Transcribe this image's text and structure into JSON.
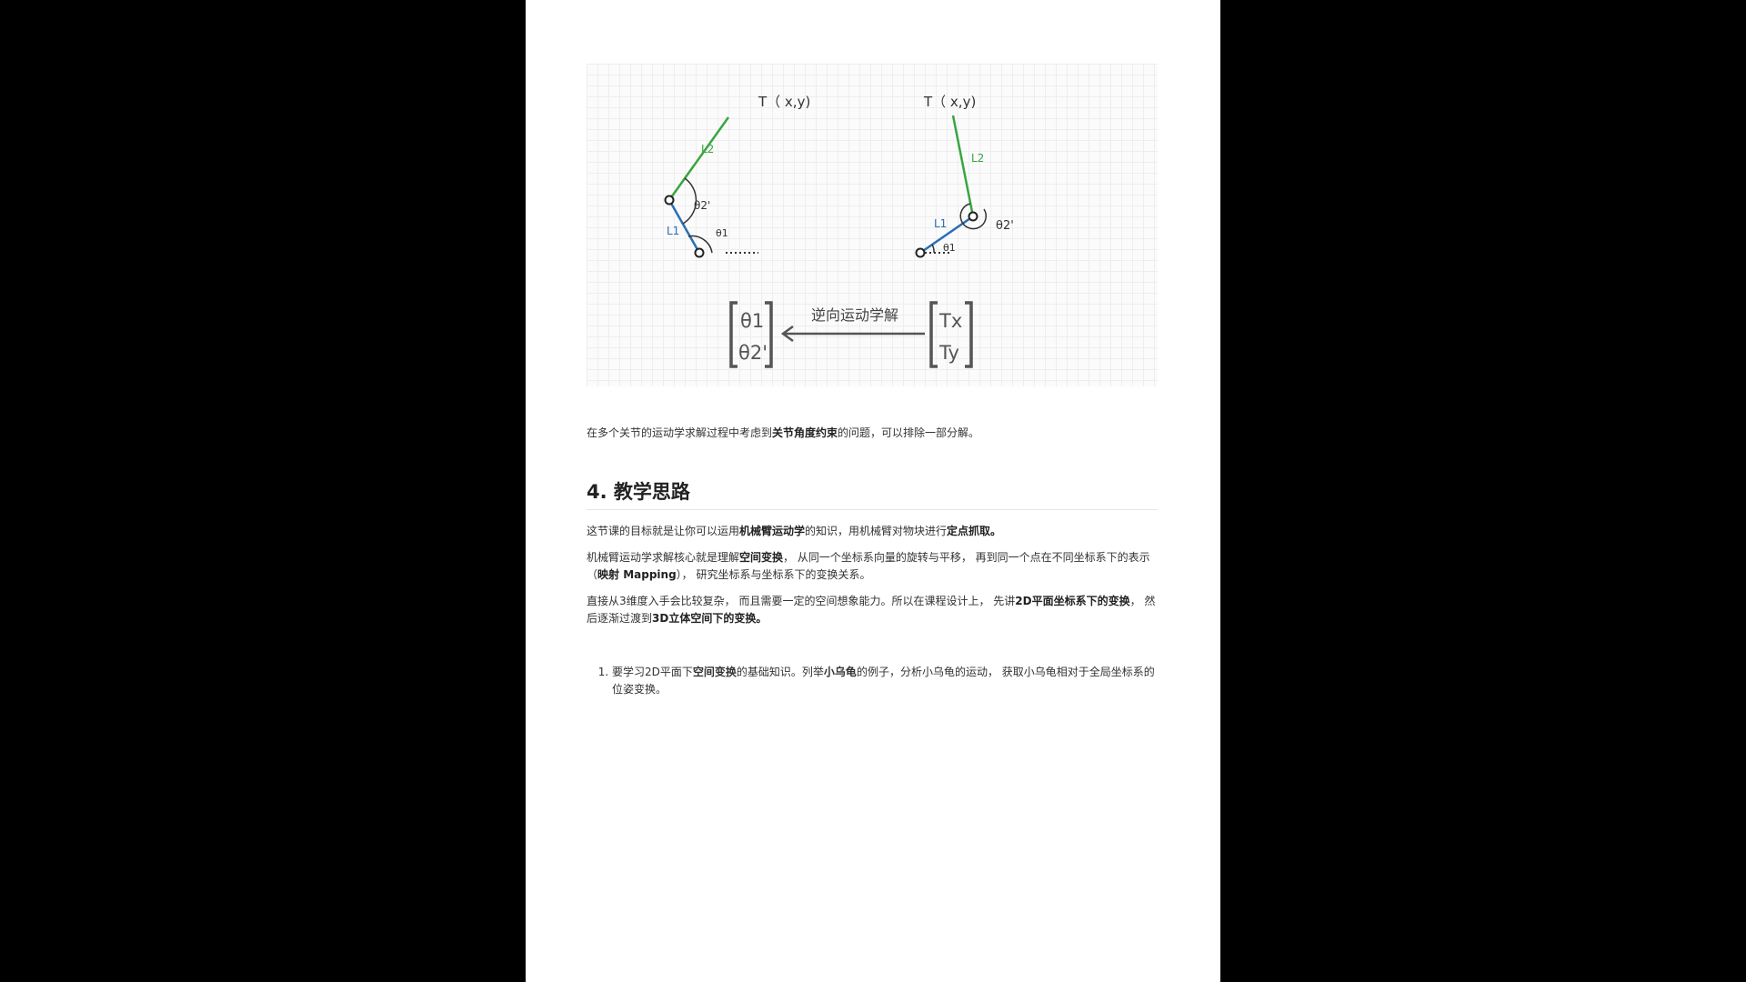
{
  "figure": {
    "left_arm": {
      "target": "T（ x,y)",
      "l2": "L2",
      "l1": "L1",
      "theta1": "θ1",
      "theta2": "θ2'"
    },
    "right_arm": {
      "target": "T（ x,y)",
      "l2": "L2",
      "l1": "L1",
      "theta1": "θ1",
      "theta2": "θ2'"
    },
    "matrix_left": [
      "θ1",
      "θ2'"
    ],
    "matrix_right": [
      "Tx",
      "Ty"
    ],
    "arrow_label": "逆向运动学解",
    "colors": {
      "l1": "#2a6fb5",
      "l2": "#3aa540",
      "ink": "#333333"
    }
  },
  "para_constraint": {
    "prefix": "在多个关节的运动学求解过程中考虑到",
    "bold": "关节角度约束",
    "suffix": "的问题，可以排除一部分解。"
  },
  "section": {
    "title": "4. 教学思路"
  },
  "para_goal": {
    "t1": "这节课的目标就是让你可以运用",
    "b1": "机械臂运动学",
    "t2": "的知识，用机械臂对物块进行",
    "b2": "定点抓取。"
  },
  "para_core": {
    "t1": "机械臂运动学求解核心就是理解",
    "b1": "空间变换",
    "t2": "， 从同一个坐标系向量的旋转与平移， 再到同一个点在不同坐标系下的表示（",
    "b2": "映射 Mapping",
    "t3": "）， 研究坐标系与坐标系下的变换关系。"
  },
  "para_design": {
    "t1": "直接从3维度入手会比较复杂， 而且需要一定的空间想象能力。所以在课程设计上， 先讲",
    "b1": "2D平面坐标系下的变换",
    "t2": "， 然后逐渐过渡到",
    "b2": "3D立体空间下的变换。"
  },
  "steps": [
    {
      "t1": "要学习2D平面下",
      "b1": "空间变换",
      "t2": "的基础知识。列举",
      "b2": "小乌龟",
      "t3": "的例子，分析小乌龟的运动， 获取小乌龟相对于全局坐标系的位姿变换。"
    }
  ]
}
